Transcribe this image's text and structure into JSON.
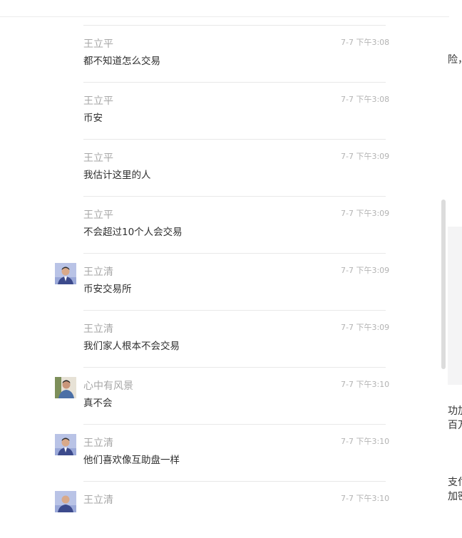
{
  "messages": [
    {
      "name": "王立平",
      "time": "7-7 下午3:08",
      "text": "都不知道怎么交易",
      "avatar": null
    },
    {
      "name": "王立平",
      "time": "7-7 下午3:08",
      "text": "币安",
      "avatar": null
    },
    {
      "name": "王立平",
      "time": "7-7 下午3:09",
      "text": "我估计这里的人",
      "avatar": null
    },
    {
      "name": "王立平",
      "time": "7-7 下午3:09",
      "text": "不会超过10个人会交易",
      "avatar": null
    },
    {
      "name": "王立清",
      "time": "7-7 下午3:09",
      "text": "币安交易所",
      "avatar": "man-in-suit-blue"
    },
    {
      "name": "王立清",
      "time": "7-7 下午3:09",
      "text": "我们家人根本不会交易",
      "avatar": null
    },
    {
      "name": "心中有风景",
      "time": "7-7 下午3:10",
      "text": "真不会",
      "avatar": "man-outdoor"
    },
    {
      "name": "王立清",
      "time": "7-7 下午3:10",
      "text": "他们喜欢像互助盘一样",
      "avatar": "man-in-suit-blue"
    },
    {
      "name": "王立清",
      "time": "7-7 下午3:10",
      "text": "",
      "avatar": "man-in-suit-blue"
    }
  ],
  "side_fragments": {
    "a": "险，",
    "b": "功加",
    "c": "百万",
    "d": "支付",
    "e": "加密"
  },
  "colors": {
    "name": "#a6a6a6",
    "time": "#b3b3b3",
    "text": "#2f2f2f",
    "separator": "#e8e8e8"
  }
}
